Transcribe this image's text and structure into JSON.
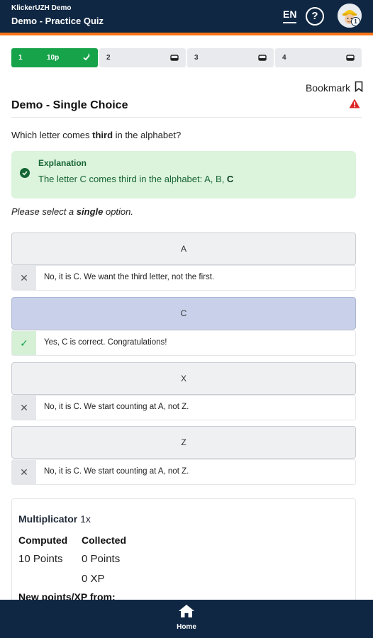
{
  "header": {
    "app_name": "KlickerUZH Demo",
    "quiz_title": "Demo - Practice Quiz",
    "language": "EN",
    "help_symbol": "?",
    "avatar_level": "1"
  },
  "steps": [
    {
      "number": "1",
      "points": "10p",
      "status": "completed",
      "icon": "check-icon"
    },
    {
      "number": "2",
      "status": "open",
      "icon": "inbox-icon"
    },
    {
      "number": "3",
      "status": "open",
      "icon": "inbox-icon"
    },
    {
      "number": "4",
      "status": "open",
      "icon": "inbox-icon"
    }
  ],
  "bookmark_label": "Bookmark",
  "question": {
    "title": "Demo - Single Choice",
    "text_before": "Which letter comes ",
    "text_emph": "third",
    "text_after": " in the alphabet?"
  },
  "explanation": {
    "title": "Explanation",
    "text": "The letter C comes third in the alphabet: A, B, ",
    "text_emph": "C"
  },
  "instruction": {
    "before": "Please select a ",
    "emph": "single",
    "after": " option."
  },
  "options": [
    {
      "label": "A",
      "selected": false,
      "correct": false,
      "feedback": "No, it is C. We want the third letter, not the first."
    },
    {
      "label": "C",
      "selected": true,
      "correct": true,
      "feedback": "Yes, C is correct. Congratulations!"
    },
    {
      "label": "X",
      "selected": false,
      "correct": false,
      "feedback": "No, it is C. We start counting at A, not Z."
    },
    {
      "label": "Z",
      "selected": false,
      "correct": false,
      "feedback": "No, it is C. We start counting at A, not Z."
    }
  ],
  "summary": {
    "multiplicator_label": "Multiplicator",
    "multiplicator_value": "1x",
    "computed_label": "Computed",
    "collected_label": "Collected",
    "computed_points": "10 Points",
    "collected_points": "0 Points",
    "collected_xp": "0 XP",
    "new_points_label": "New points/XP from:"
  },
  "footer": {
    "home_label": "Home"
  },
  "colors": {
    "navy": "#0f2743",
    "accent": "#f97316",
    "success": "#16a34a",
    "selected": "#c8d0ea"
  }
}
